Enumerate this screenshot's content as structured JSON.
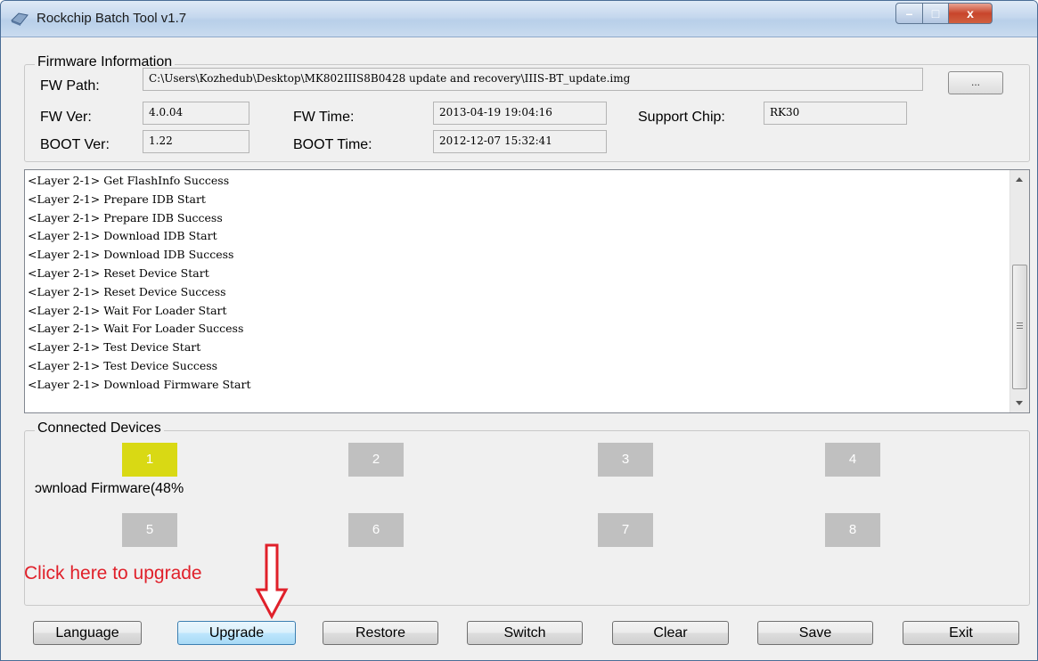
{
  "window": {
    "title": "Rockchip Batch Tool v1.7",
    "controls": {
      "minimize": "–",
      "maximize": "□",
      "close": "x"
    }
  },
  "firmware": {
    "group_title": "Firmware Information",
    "fw_path_label": "FW Path:",
    "fw_path_value": "C:\\Users\\Kozhedub\\Desktop\\MK802IIIS8B0428 update and recovery\\IIIS-BT_update.img",
    "browse_label": "...",
    "fw_ver_label": "FW Ver:",
    "fw_ver_value": "4.0.04",
    "fw_time_label": "FW Time:",
    "fw_time_value": "2013-04-19 19:04:16",
    "support_chip_label": "Support Chip:",
    "support_chip_value": "RK30",
    "boot_ver_label": "BOOT Ver:",
    "boot_ver_value": "1.22",
    "boot_time_label": "BOOT Time:",
    "boot_time_value": "2012-12-07 15:32:41"
  },
  "log": {
    "lines": [
      "<Layer 2-1> Get FlashInfo Success",
      "<Layer 2-1> Prepare IDB Start",
      "<Layer 2-1> Prepare IDB Success",
      "<Layer 2-1> Download IDB Start",
      "<Layer 2-1> Download IDB Success",
      "<Layer 2-1> Reset Device Start",
      "<Layer 2-1> Reset Device Success",
      "<Layer 2-1> Wait For Loader Start",
      "<Layer 2-1> Wait For Loader Success",
      "<Layer 2-1> Test Device Start",
      "<Layer 2-1> Test Device Success",
      "<Layer 2-1> Download Firmware Start"
    ]
  },
  "devices": {
    "group_title": "Connected Devices",
    "slots": [
      "1",
      "2",
      "3",
      "4",
      "5",
      "6",
      "7",
      "8"
    ],
    "active_color": "#d9d914",
    "inactive_color": "#c0c0c0",
    "status_text": "ɔwnload Firmware(48%"
  },
  "annotation": {
    "hint_text": "Click here to upgrade",
    "color": "#e0202a"
  },
  "buttons": {
    "language": "Language",
    "upgrade": "Upgrade",
    "restore": "Restore",
    "switch": "Switch",
    "clear": "Clear",
    "save": "Save",
    "exit": "Exit"
  }
}
